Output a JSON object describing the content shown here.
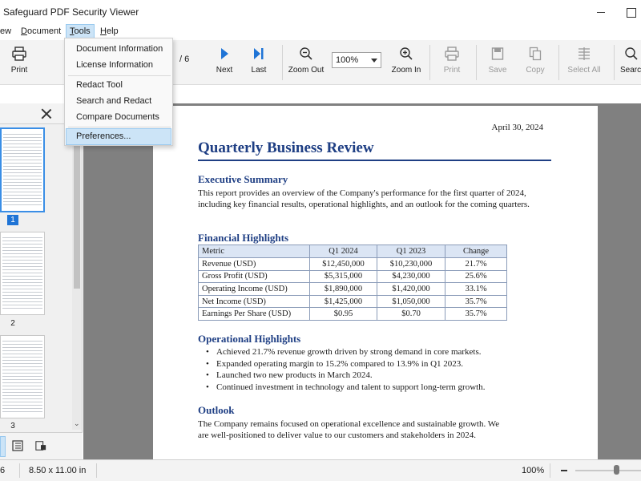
{
  "window": {
    "title": "d Safeguard PDF Security Viewer"
  },
  "menubar": {
    "items": [
      {
        "label": "ew"
      },
      {
        "label": "Document"
      },
      {
        "label": "Tools"
      },
      {
        "label": "Help"
      }
    ]
  },
  "tools_menu": {
    "items": [
      "Document Information",
      "License Information",
      "Redact Tool",
      "Search and Redact",
      "Compare Documents",
      "Preferences..."
    ]
  },
  "toolbar": {
    "print": "Print",
    "page_total": "/ 6",
    "next": "Next",
    "last": "Last",
    "zoom_out": "Zoom Out",
    "zoom_value": "100%",
    "zoom_in": "Zoom In",
    "print2": "Print",
    "save": "Save",
    "copy": "Copy",
    "select_all": "Select All",
    "search": "Search"
  },
  "sidebar": {
    "thumbnails": [
      {
        "num": "1",
        "selected": true
      },
      {
        "num": "2"
      },
      {
        "num": "3"
      }
    ]
  },
  "document": {
    "date": "April 30, 2024",
    "title": "Quarterly Business Review",
    "exec_heading": "Executive Summary",
    "exec_text": "This report provides an overview of the Company's performance for the first quarter of 2024, including key financial results, operational highlights, and an outlook for the coming quarters.",
    "fin_heading": "Financial Highlights",
    "table": {
      "headers": [
        "Metric",
        "Q1 2024",
        "Q1 2023",
        "Change"
      ],
      "rows": [
        [
          "Revenue (USD)",
          "$12,450,000",
          "$10,230,000",
          "21.7%"
        ],
        [
          "Gross Profit (USD)",
          "$5,315,000",
          "$4,230,000",
          "25.6%"
        ],
        [
          "Operating Income (USD)",
          "$1,890,000",
          "$1,420,000",
          "33.1%"
        ],
        [
          "Net Income (USD)",
          "$1,425,000",
          "$1,050,000",
          "35.7%"
        ],
        [
          "Earnings Per Share (USD)",
          "$0.95",
          "$0.70",
          "35.7%"
        ]
      ]
    },
    "ops_heading": "Operational Highlights",
    "ops_items": [
      "Achieved 21.7% revenue growth driven by strong demand in core markets.",
      "Expanded operating margin to 15.2% compared to 13.9% in Q1 2023.",
      "Launched two new products in March 2024.",
      "Continued investment in technology and talent to support long-term growth."
    ],
    "outlook_heading": "Outlook",
    "outlook_text": "The Company remains focused on operational excellence and sustainable growth. We are well-positioned to deliver value to our customers and stakeholders in 2024."
  },
  "statusbar": {
    "page": "6",
    "page_size": "8.50 x 11.00 in",
    "zoom": "100%"
  }
}
